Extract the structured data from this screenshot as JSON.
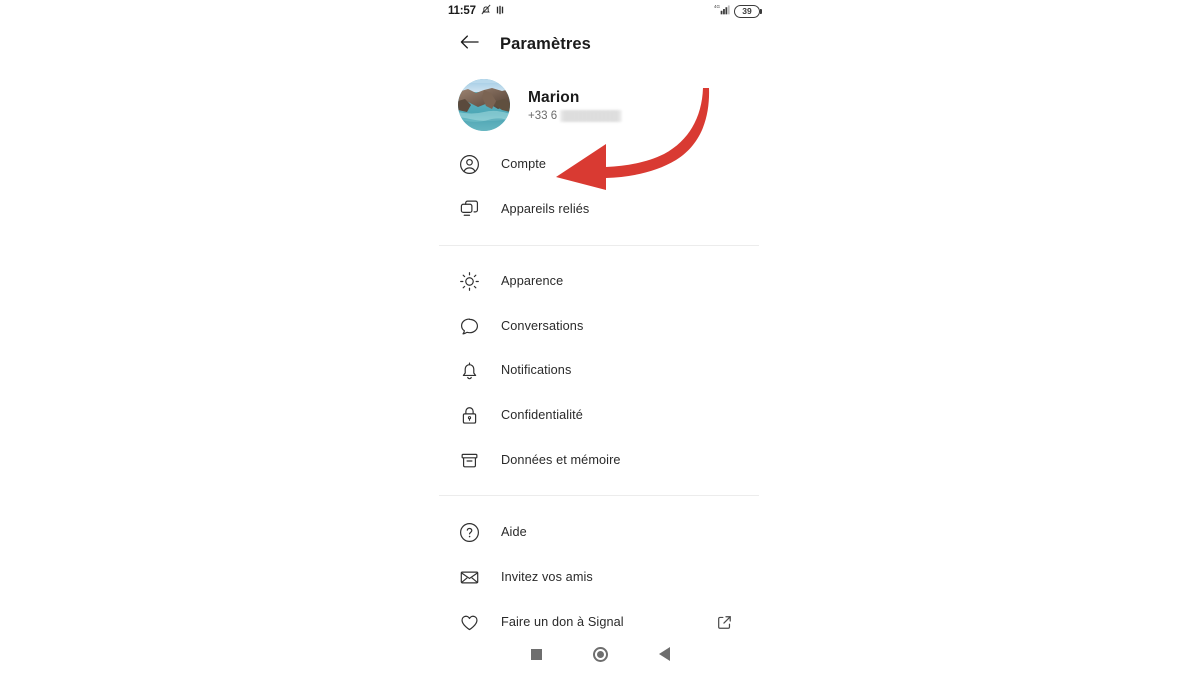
{
  "status_bar": {
    "clock": "11:57",
    "left_icons": [
      "bell-muted-icon",
      "vibrate-icon"
    ],
    "right_icons": [
      "cellular-signal-4g-icon",
      "battery-icon"
    ],
    "battery_level": "39"
  },
  "app_bar": {
    "back_icon": "arrow-left-icon",
    "title": "Paramètres"
  },
  "profile": {
    "avatar_alt": "coastal-cliff-photo",
    "name": "Marion",
    "phone_prefix": "+33 6",
    "phone_redacted": true
  },
  "sections": [
    {
      "id": "account-section",
      "items": [
        {
          "id": "compte",
          "icon": "person-circle-icon",
          "label": "Compte"
        },
        {
          "id": "appareils-relies",
          "icon": "linked-devices-icon",
          "label": "Appareils reliés"
        }
      ]
    },
    {
      "id": "preferences-section",
      "items": [
        {
          "id": "apparence",
          "icon": "brightness-sun-icon",
          "label": "Apparence"
        },
        {
          "id": "conversations",
          "icon": "chat-bubble-icon",
          "label": "Conversations"
        },
        {
          "id": "notifications",
          "icon": "bell-icon",
          "label": "Notifications"
        },
        {
          "id": "confidentialite",
          "icon": "lock-icon",
          "label": "Confidentialité"
        },
        {
          "id": "donnees-memoire",
          "icon": "archive-box-icon",
          "label": "Données et mémoire"
        }
      ]
    },
    {
      "id": "support-section",
      "items": [
        {
          "id": "aide",
          "icon": "question-circle-icon",
          "label": "Aide"
        },
        {
          "id": "invitez",
          "icon": "envelope-icon",
          "label": "Invitez vos amis"
        },
        {
          "id": "faire-un-don",
          "icon": "heart-icon",
          "label": "Faire un don à Signal",
          "trailing_icon": "external-link-icon"
        }
      ]
    }
  ],
  "nav_bar": {
    "recents_label": "recents-button",
    "home_label": "home-button",
    "back_label": "back-button"
  },
  "annotation": {
    "type": "curved-arrow",
    "color": "#d93a32",
    "points_at": "Compte"
  }
}
